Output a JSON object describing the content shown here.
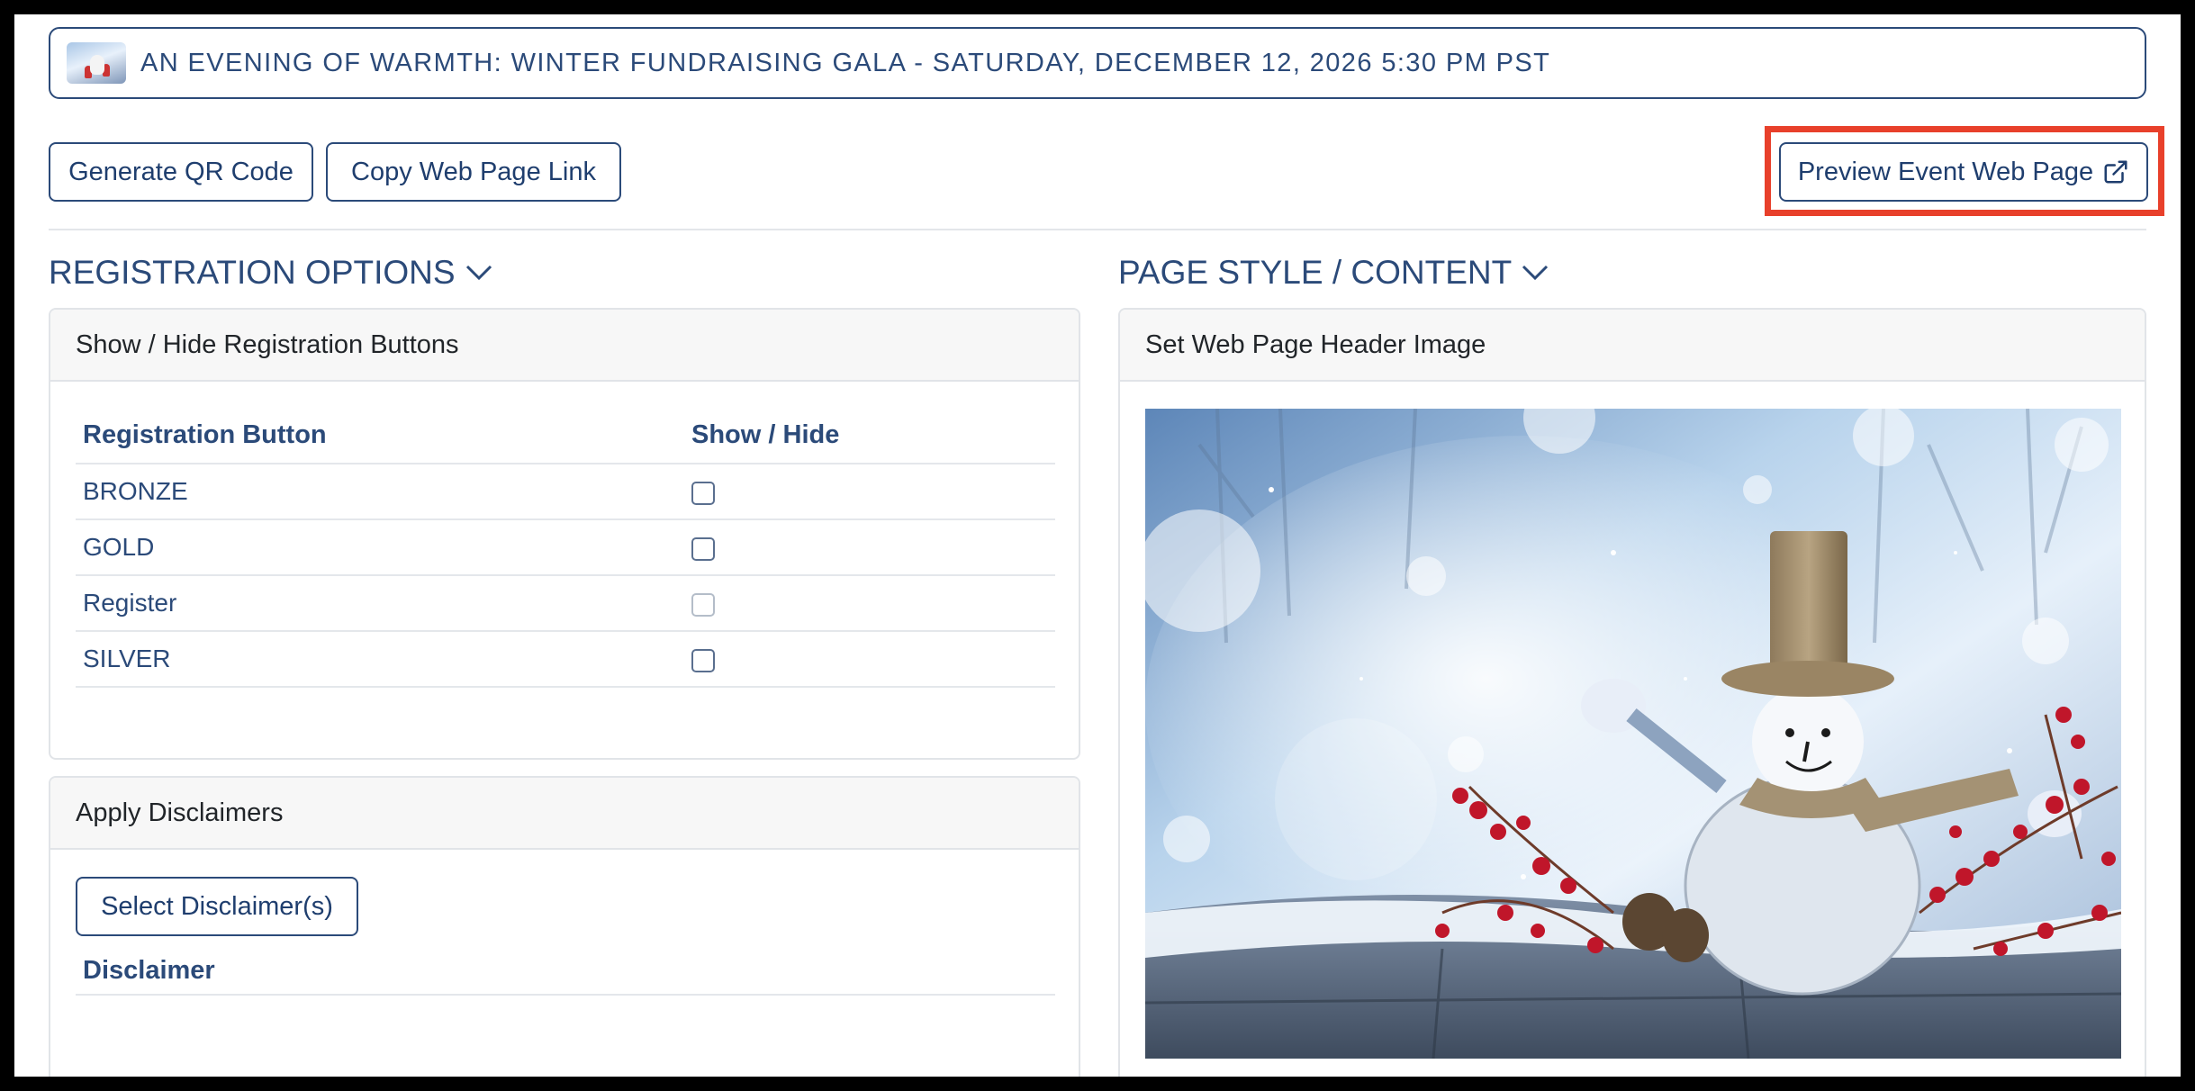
{
  "event": {
    "title": "AN EVENING OF WARMTH: WINTER FUNDRAISING GALA - SATURDAY, DECEMBER 12, 2026 5:30 PM PST",
    "thumbnail_icon": "event-thumbnail-image"
  },
  "toolbar": {
    "qr_label": "Generate QR Code",
    "copy_label": "Copy Web Page Link",
    "preview_label": "Preview Event Web Page",
    "preview_icon": "external-link-icon"
  },
  "highlight_color": "#e8402b",
  "accent_color": "#2b4a79",
  "registration": {
    "section_title": "REGISTRATION OPTIONS",
    "card_title": "Show / Hide Registration Buttons",
    "columns": [
      "Registration Button",
      "Show / Hide"
    ],
    "rows": [
      {
        "name": "BRONZE",
        "checked": false,
        "enabled": true
      },
      {
        "name": "GOLD",
        "checked": false,
        "enabled": true
      },
      {
        "name": "Register",
        "checked": false,
        "enabled": false
      },
      {
        "name": "SILVER",
        "checked": false,
        "enabled": true
      }
    ]
  },
  "disclaimers": {
    "card_title": "Apply Disclaimers",
    "select_label": "Select Disclaimer(s)",
    "column": "Disclaimer"
  },
  "page_style": {
    "section_title": "PAGE STYLE / CONTENT",
    "card_title": "Set Web Page Header Image",
    "image_subject": "snowman-winter-header-image"
  }
}
